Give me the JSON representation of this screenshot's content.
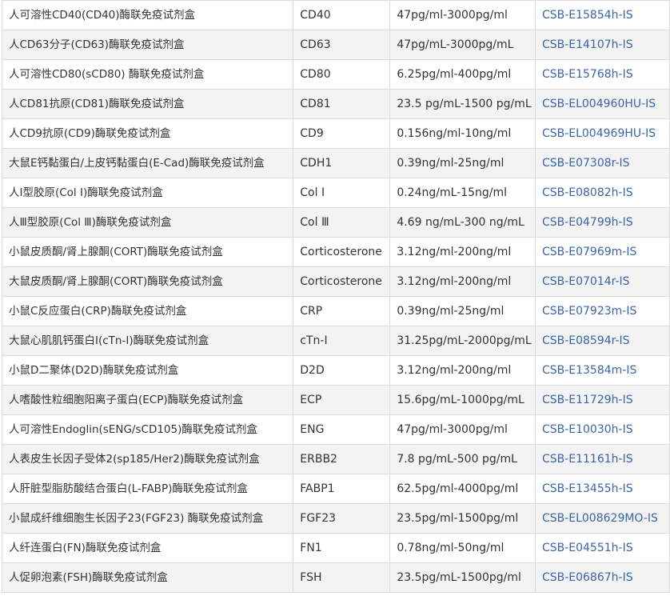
{
  "table": {
    "rows": [
      {
        "name": "人可溶性CD40(CD40)酶联免疫试剂盒",
        "target": "CD40",
        "range": "47pg/ml-3000pg/ml",
        "code": "CSB-E15854h-IS"
      },
      {
        "name": "人CD63分子(CD63)酶联免疫试剂盒",
        "target": "CD63",
        "range": "47pg/mL-3000pg/mL",
        "code": "CSB-E14107h-IS"
      },
      {
        "name": "人可溶性CD80(sCD80) 酶联免疫试剂盒",
        "target": "CD80",
        "range": "6.25pg/ml-400pg/ml",
        "code": "CSB-E15768h-IS"
      },
      {
        "name": "人CD81抗原(CD81)酶联免疫试剂盒",
        "target": "CD81",
        "range": "23.5 pg/mL-1500 pg/mL",
        "code": "CSB-EL004960HU-IS"
      },
      {
        "name": "人CD9抗原(CD9)酶联免疫试剂盒",
        "target": "CD9",
        "range": "0.156ng/ml-10ng/ml",
        "code": "CSB-EL004969HU-IS"
      },
      {
        "name": "大鼠E钙黏蛋白/上皮钙黏蛋白(E-Cad)酶联免疫试剂盒",
        "target": "CDH1",
        "range": "0.39ng/ml-25ng/ml",
        "code": "CSB-E07308r-IS"
      },
      {
        "name": "人Ⅰ型胶原(Col Ⅰ)酶联免疫试剂盒",
        "target": "Col Ⅰ",
        "range": "0.24ng/mL-15ng/ml",
        "code": "CSB-E08082h-IS"
      },
      {
        "name": "人Ⅲ型胶原(Col Ⅲ)酶联免疫试剂盒",
        "target": "Col Ⅲ",
        "range": "4.69 ng/mL-300 ng/mL",
        "code": "CSB-E04799h-IS"
      },
      {
        "name": "小鼠皮质酮/肾上腺酮(CORT)酶联免疫试剂盒",
        "target": "Corticosterone",
        "range": "3.12ng/ml-200ng/ml",
        "code": "CSB-E07969m-IS"
      },
      {
        "name": "大鼠皮质酮/肾上腺酮(CORT)酶联免疫试剂盒",
        "target": "Corticosterone",
        "range": "3.12ng/ml-200ng/ml",
        "code": "CSB-E07014r-IS"
      },
      {
        "name": "小鼠C反应蛋白(CRP)酶联免疫试剂盒",
        "target": "CRP",
        "range": "0.39ng/ml-25ng/ml",
        "code": "CSB-E07923m-IS"
      },
      {
        "name": "大鼠心肌肌钙蛋白Ⅰ(cTn-Ⅰ)酶联免疫试剂盒",
        "target": "cTn-I",
        "range": "31.25pg/mL-2000pg/mL",
        "code": "CSB-E08594r-IS"
      },
      {
        "name": "小鼠D二聚体(D2D)酶联免疫试剂盒",
        "target": "D2D",
        "range": "3.12ng/ml-200ng/ml",
        "code": "CSB-E13584m-IS"
      },
      {
        "name": "人嗜酸性粒细胞阳离子蛋白(ECP)酶联免疫试剂盒",
        "target": "ECP",
        "range": "15.6pg/mL-1000pg/mL",
        "code": "CSB-E11729h-IS"
      },
      {
        "name": "人可溶性Endoglin(sENG/sCD105)酶联免疫试剂盒",
        "target": "ENG",
        "range": "47pg/ml-3000pg/ml",
        "code": "CSB-E10030h-IS"
      },
      {
        "name": "人表皮生长因子受体2(sp185/Her2)酶联免疫试剂盒",
        "target": "ERBB2",
        "range": "7.8 pg/mL-500 pg/mL",
        "code": "CSB-E11161h-IS"
      },
      {
        "name": "人肝脏型脂肪酸结合蛋白(L-FABP)酶联免疫试剂盒",
        "target": "FABP1",
        "range": "62.5pg/ml-4000pg/ml",
        "code": "CSB-E13455h-IS"
      },
      {
        "name": "小鼠成纤维细胞生长因子23(FGF23) 酶联免疫试剂盒",
        "target": "FGF23",
        "range": "23.5pg/ml-1500pg/ml",
        "code": "CSB-EL008629MO-IS"
      },
      {
        "name": "人纤连蛋白(FN)酶联免疫试剂盒",
        "target": "FN1",
        "range": "0.78ng/ml-50ng/ml",
        "code": "CSB-E04551h-IS"
      },
      {
        "name": "人促卵泡素(FSH)酶联免疫试剂盒",
        "target": "FSH",
        "range": "23.5pg/mL-1500pg/ml",
        "code": "CSB-E06867h-IS"
      }
    ]
  }
}
